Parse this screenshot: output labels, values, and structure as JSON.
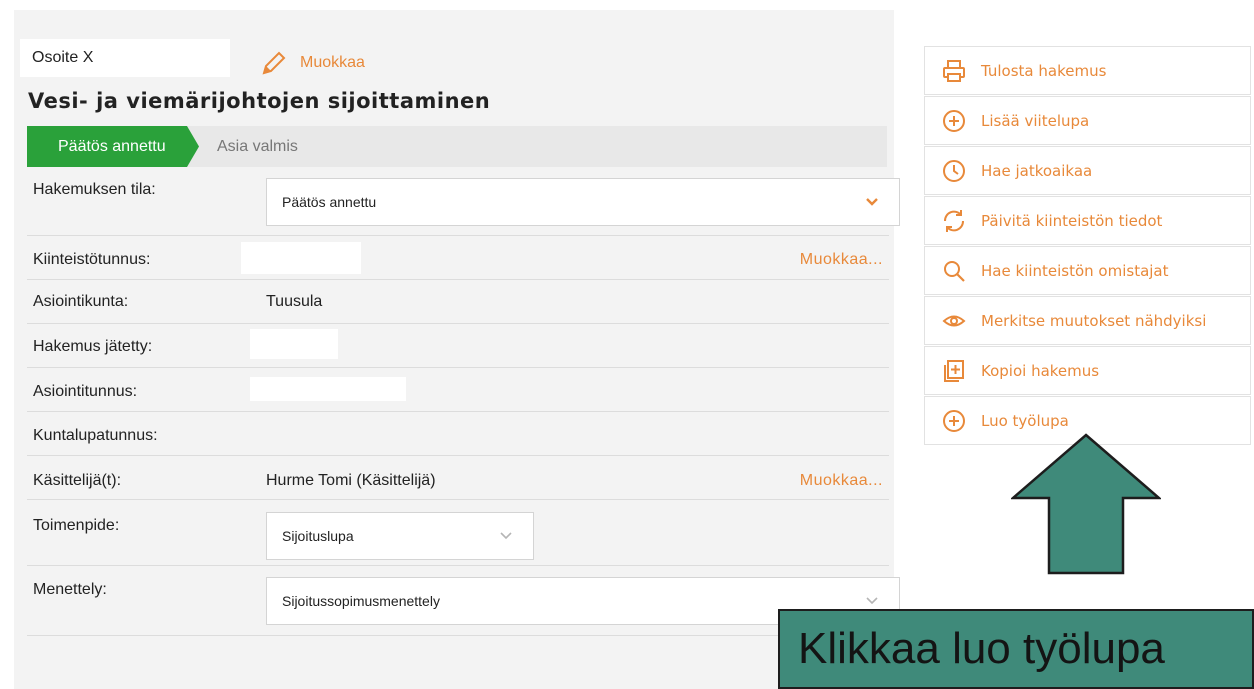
{
  "header": {
    "address": "Osoite X",
    "edit_label": "Muokkaa",
    "title": "Vesi- ja viemärijohtojen sijoittaminen"
  },
  "status": {
    "active_step": "Päätös annettu",
    "next_step": "Asia valmis"
  },
  "form": {
    "state_label": "Hakemuksen tila:",
    "state_value": "Päätös annettu",
    "property_label": "Kiinteistötunnus:",
    "property_edit": "Muokkaa...",
    "municipality_label": "Asiointikunta:",
    "municipality_value": "Tuusula",
    "submitted_label": "Hakemus jätetty:",
    "case_id_label": "Asiointitunnus:",
    "permit_id_label": "Kuntalupatunnus:",
    "handler_label": "Käsittelijä(t):",
    "handler_value": "Hurme Tomi (Käsittelijä)",
    "handler_edit": "Muokkaa...",
    "action_label": "Toimenpide:",
    "action_value": "Sijoituslupa",
    "procedure_label": "Menettely:",
    "procedure_value": "Sijoitussopimusmenettely"
  },
  "sidebar": {
    "items": [
      {
        "label": "Tulosta hakemus",
        "icon": "printer-icon"
      },
      {
        "label": "Lisää viitelupa",
        "icon": "plus-circle-icon"
      },
      {
        "label": "Hae jatkoaikaa",
        "icon": "clock-icon"
      },
      {
        "label": "Päivitä kiinteistön tiedot",
        "icon": "refresh-icon"
      },
      {
        "label": "Hae kiinteistön omistajat",
        "icon": "search-icon"
      },
      {
        "label": "Merkitse muutokset nähdyiksi",
        "icon": "eye-icon"
      },
      {
        "label": "Kopioi hakemus",
        "icon": "copy-icon"
      },
      {
        "label": "Luo työlupa",
        "icon": "plus-circle-icon"
      }
    ]
  },
  "callout": {
    "text": "Klikkaa luo työlupa"
  },
  "colors": {
    "accent": "#e8893a",
    "active_step": "#2aa13a",
    "callout": "#3f8a7a"
  }
}
